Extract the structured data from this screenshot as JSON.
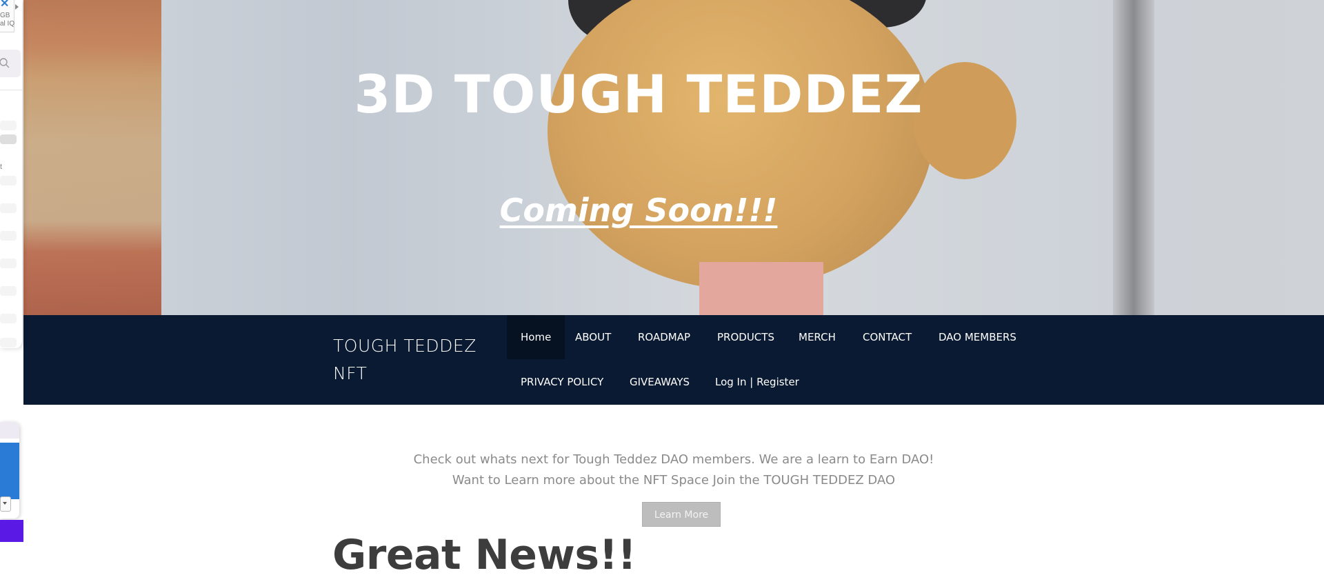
{
  "side_panel": {
    "tiny_text": "GB\nal IQ",
    "row_text": "t"
  },
  "hero": {
    "title": "3D TOUGH TEDDEZ",
    "subtitle": "Coming Soon!!!"
  },
  "nav": {
    "brand": "TOUGH TEDDEZ NFT",
    "row1": [
      "Home",
      "ABOUT",
      "ROADMAP",
      "PRODUCTS",
      "MERCH",
      "CONTACT",
      "DAO MEMBERS"
    ],
    "row2": [
      "PRIVACY POLICY",
      "GIVEAWAYS",
      "Log In | Register"
    ],
    "active": "Home"
  },
  "content": {
    "intro_line1": "Check out whats next for Tough Teddez DAO members. We are a learn to Earn DAO!",
    "intro_line2": "Want to Learn more about the NFT Space Join the TOUGH TEDDEZ DAO",
    "learn_more": "Learn More",
    "heading": "Great News!!"
  },
  "colors": {
    "nav_bg": "#0b1a33",
    "nav_active_bg": "#061222",
    "button_bg": "#bdbdbd",
    "heading": "#3d3d3d"
  }
}
